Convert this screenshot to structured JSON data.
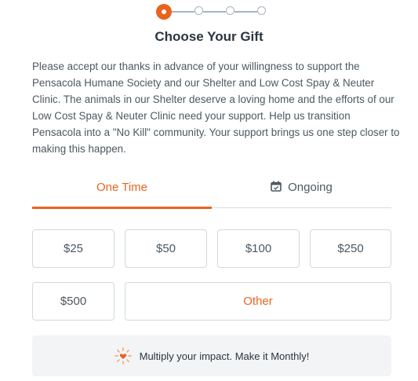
{
  "stepper": {
    "total_steps": 4,
    "current_step": 1,
    "active_color": "#e8641e"
  },
  "title": "Choose Your Gift",
  "description": "Please accept our thanks in advance of your willingness to support the Pensacola Humane Society and our Shelter and Low Cost Spay & Neuter Clinic. The animals in our Shelter deserve a loving home and the efforts of our Low Cost Spay & Neuter Clinic need your support. Help us transition Pensacola into a \"No Kill\" community. Your support brings us one step closer to making this happen.",
  "tabs": [
    {
      "label": "One Time",
      "active": true
    },
    {
      "label": "Ongoing",
      "active": false,
      "icon": "calendar-icon"
    }
  ],
  "amounts": [
    "$25",
    "$50",
    "$100",
    "$250",
    "$500"
  ],
  "other_label": "Other",
  "banner": {
    "text": "Multiply your impact. Make it Monthly!",
    "icon": "heart-burst-icon"
  },
  "colors": {
    "accent": "#e8641e",
    "text": "#4d5862",
    "border": "#d3d8dc"
  }
}
